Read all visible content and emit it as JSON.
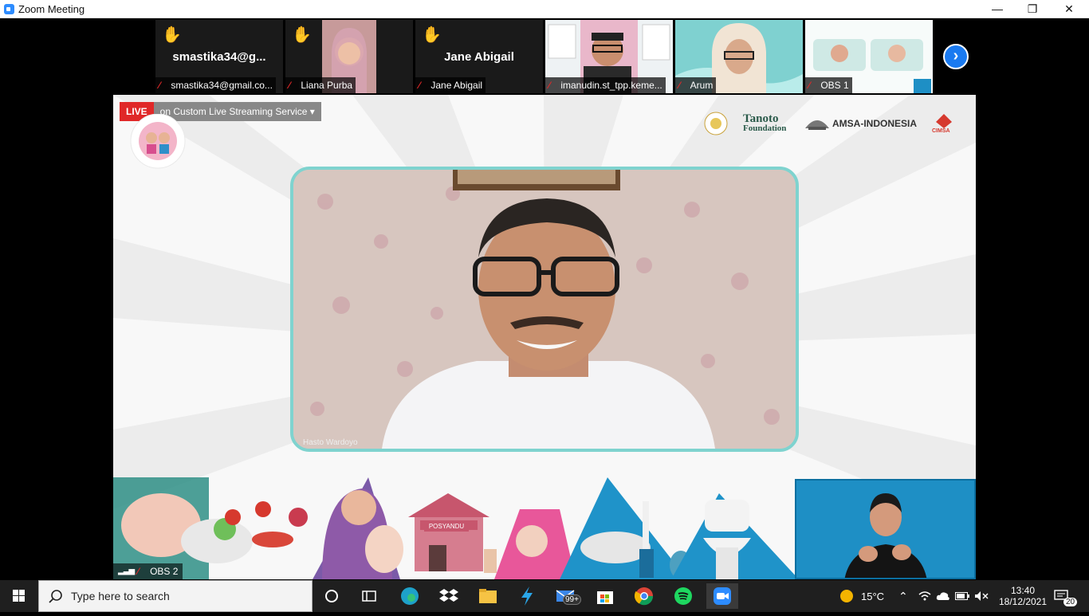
{
  "window": {
    "title": "Zoom Meeting",
    "minimize": "—",
    "restore": "❐",
    "close": "✕"
  },
  "participants": [
    {
      "big_name": "smastika34@g...",
      "label": "smastika34@gmail.co...",
      "hand": "✋"
    },
    {
      "big_name": "",
      "label": "Liana Purba",
      "hand": "✋"
    },
    {
      "big_name": "Jane Abigail",
      "label": "Jane Abigail",
      "hand": "✋"
    },
    {
      "big_name": "",
      "label": "imanudin.st_tpp.keme...",
      "hand": ""
    },
    {
      "big_name": "",
      "label": "Arum",
      "hand": ""
    },
    {
      "big_name": "",
      "label": "OBS 1",
      "hand": ""
    }
  ],
  "share": {
    "live_label": "LIVE",
    "stream_label": "on Custom Live Streaming Service",
    "dropdown": "▾",
    "logos": {
      "tanoto_1": "Tanoto",
      "tanoto_2": "Foundation",
      "amsa": "AMSA-INDONESIA",
      "cimsa": "CIMSA"
    },
    "speaker_name": "Hasto Wardoyo",
    "posyandu": "POSYANDU",
    "obs2": "OBS 2"
  },
  "taskbar": {
    "search_placeholder": "Type here to search",
    "mail_badge": "99+",
    "temperature": "15°C",
    "time": "13:40",
    "date": "18/12/2021",
    "notifications": "20"
  }
}
